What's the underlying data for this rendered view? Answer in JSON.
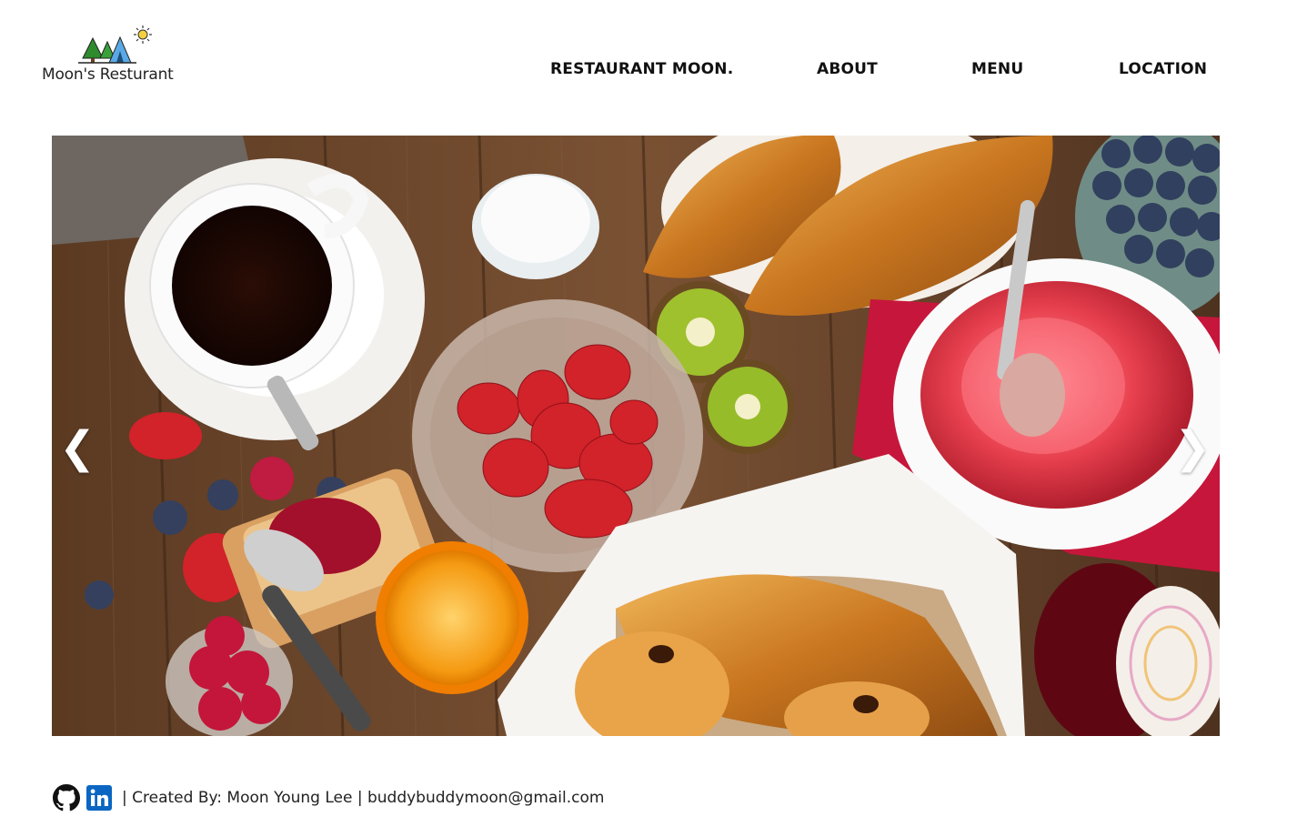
{
  "logo": {
    "text": "Moon's Resturant",
    "icon": "tent-trees-sun-icon"
  },
  "nav": {
    "items": [
      {
        "label": "RESTAURANT MOON."
      },
      {
        "label": "ABOUT"
      },
      {
        "label": "MENU"
      },
      {
        "label": "LOCATION"
      }
    ]
  },
  "hero": {
    "image": "breakfast-table-photo",
    "prev_glyph": "❮",
    "next_glyph": "❯"
  },
  "footer": {
    "github_icon": "github-icon",
    "linkedin_icon": "linkedin-icon",
    "credits": "| Created By: Moon Young Lee | buddybuddymoon@gmail.com"
  },
  "colors": {
    "text": "#111111",
    "linkedin": "#0a66c2",
    "background": "#ffffff"
  }
}
